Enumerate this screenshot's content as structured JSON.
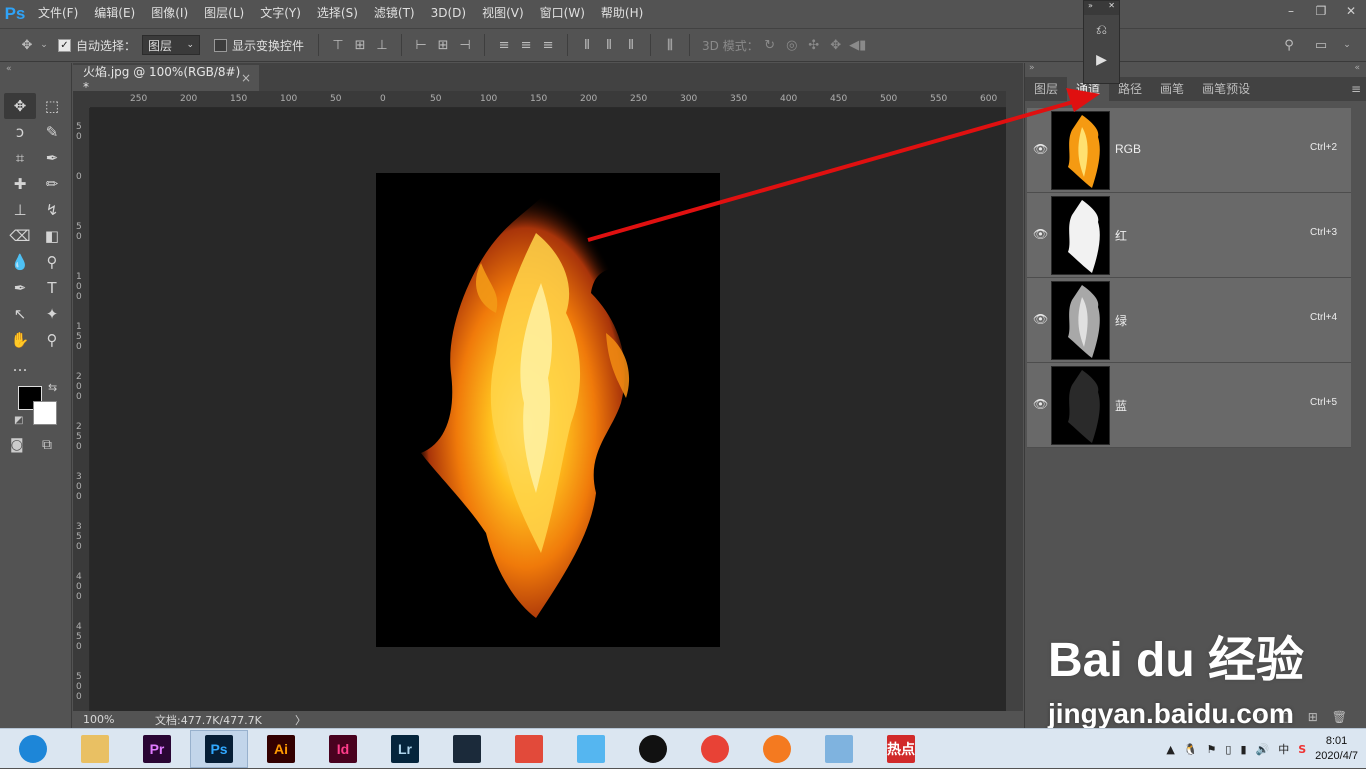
{
  "app": {
    "logo": "Ps"
  },
  "menu": [
    "文件(F)",
    "编辑(E)",
    "图像(I)",
    "图层(L)",
    "文字(Y)",
    "选择(S)",
    "滤镜(T)",
    "3D(D)",
    "视图(V)",
    "窗口(W)",
    "帮助(H)"
  ],
  "window_controls": {
    "minimize": "–",
    "restore": "❐",
    "close": "✕"
  },
  "options": {
    "auto_select_label": "自动选择：",
    "auto_select_checked": true,
    "layer_select_value": "图层",
    "show_transform_label": "显示变换控件",
    "mode3d_label": "3D 模式："
  },
  "document": {
    "tab_title": "火焰.jpg @ 100%(RGB/8#) *",
    "close": "×",
    "zoom": "100%",
    "doc_info": "文档:477.7K/477.7K",
    "status_arrow": "〉"
  },
  "rulers": {
    "h_labels": [
      "250",
      "200",
      "150",
      "100",
      "50",
      "0",
      "50",
      "100",
      "150",
      "200",
      "250",
      "300",
      "350",
      "400",
      "450",
      "500",
      "550",
      "600"
    ],
    "v_labels": [
      "50",
      "0",
      "50",
      "100",
      "150",
      "200",
      "250",
      "300",
      "350",
      "400",
      "450",
      "500"
    ]
  },
  "panel": {
    "tabs": [
      "图层",
      "通道",
      "路径",
      "画笔",
      "画笔预设"
    ],
    "active_tab": "通道",
    "channels": [
      {
        "name": "RGB",
        "shortcut": "Ctrl+2",
        "thumb": "color"
      },
      {
        "name": "红",
        "shortcut": "Ctrl+3",
        "thumb": "bright"
      },
      {
        "name": "绿",
        "shortcut": "Ctrl+4",
        "thumb": "mid"
      },
      {
        "name": "蓝",
        "shortcut": "Ctrl+5",
        "thumb": "dark"
      }
    ]
  },
  "mini_panel": {
    "top_left": "»",
    "top_right": "✕",
    "history_icon": "history-icon",
    "play_icon": "play-icon"
  },
  "taskbar": {
    "apps": [
      {
        "name": "browser",
        "label": "",
        "color": "#1d86d8"
      },
      {
        "name": "explorer",
        "label": "",
        "color": "#e9c063"
      },
      {
        "name": "premiere",
        "label": "Pr",
        "color": "#2a0634",
        "fg": "#e07bff"
      },
      {
        "name": "photoshop",
        "label": "Ps",
        "color": "#061e36",
        "fg": "#31a8ff",
        "active": true
      },
      {
        "name": "illustrator",
        "label": "Ai",
        "color": "#330000",
        "fg": "#ff9a00"
      },
      {
        "name": "indesign",
        "label": "Id",
        "color": "#49021f",
        "fg": "#ff3d8b"
      },
      {
        "name": "lightroom",
        "label": "Lr",
        "color": "#05253c",
        "fg": "#add5ec"
      },
      {
        "name": "video",
        "label": "",
        "color": "#1b2a3a"
      },
      {
        "name": "app-umbrella",
        "label": "",
        "color": "#e24a3a"
      },
      {
        "name": "app-rabbit",
        "label": "",
        "color": "#55b6f0"
      },
      {
        "name": "qq",
        "label": "",
        "color": "#111111"
      },
      {
        "name": "chrome",
        "label": "",
        "color": "#e84236"
      },
      {
        "name": "app-orange",
        "label": "",
        "color": "#f47a20"
      },
      {
        "name": "app-blue",
        "label": "",
        "color": "#7fb3df"
      },
      {
        "name": "hot",
        "label": "热点",
        "color": "#d12a2a",
        "fg": "#ffffff"
      }
    ],
    "tray": {
      "ime": "中",
      "time": "8:01",
      "date": "2020/4/7"
    }
  },
  "watermark": {
    "logo": "Bai du 经验",
    "url": "jingyan.baidu.com"
  },
  "annotation": {
    "color": "#e01010"
  }
}
